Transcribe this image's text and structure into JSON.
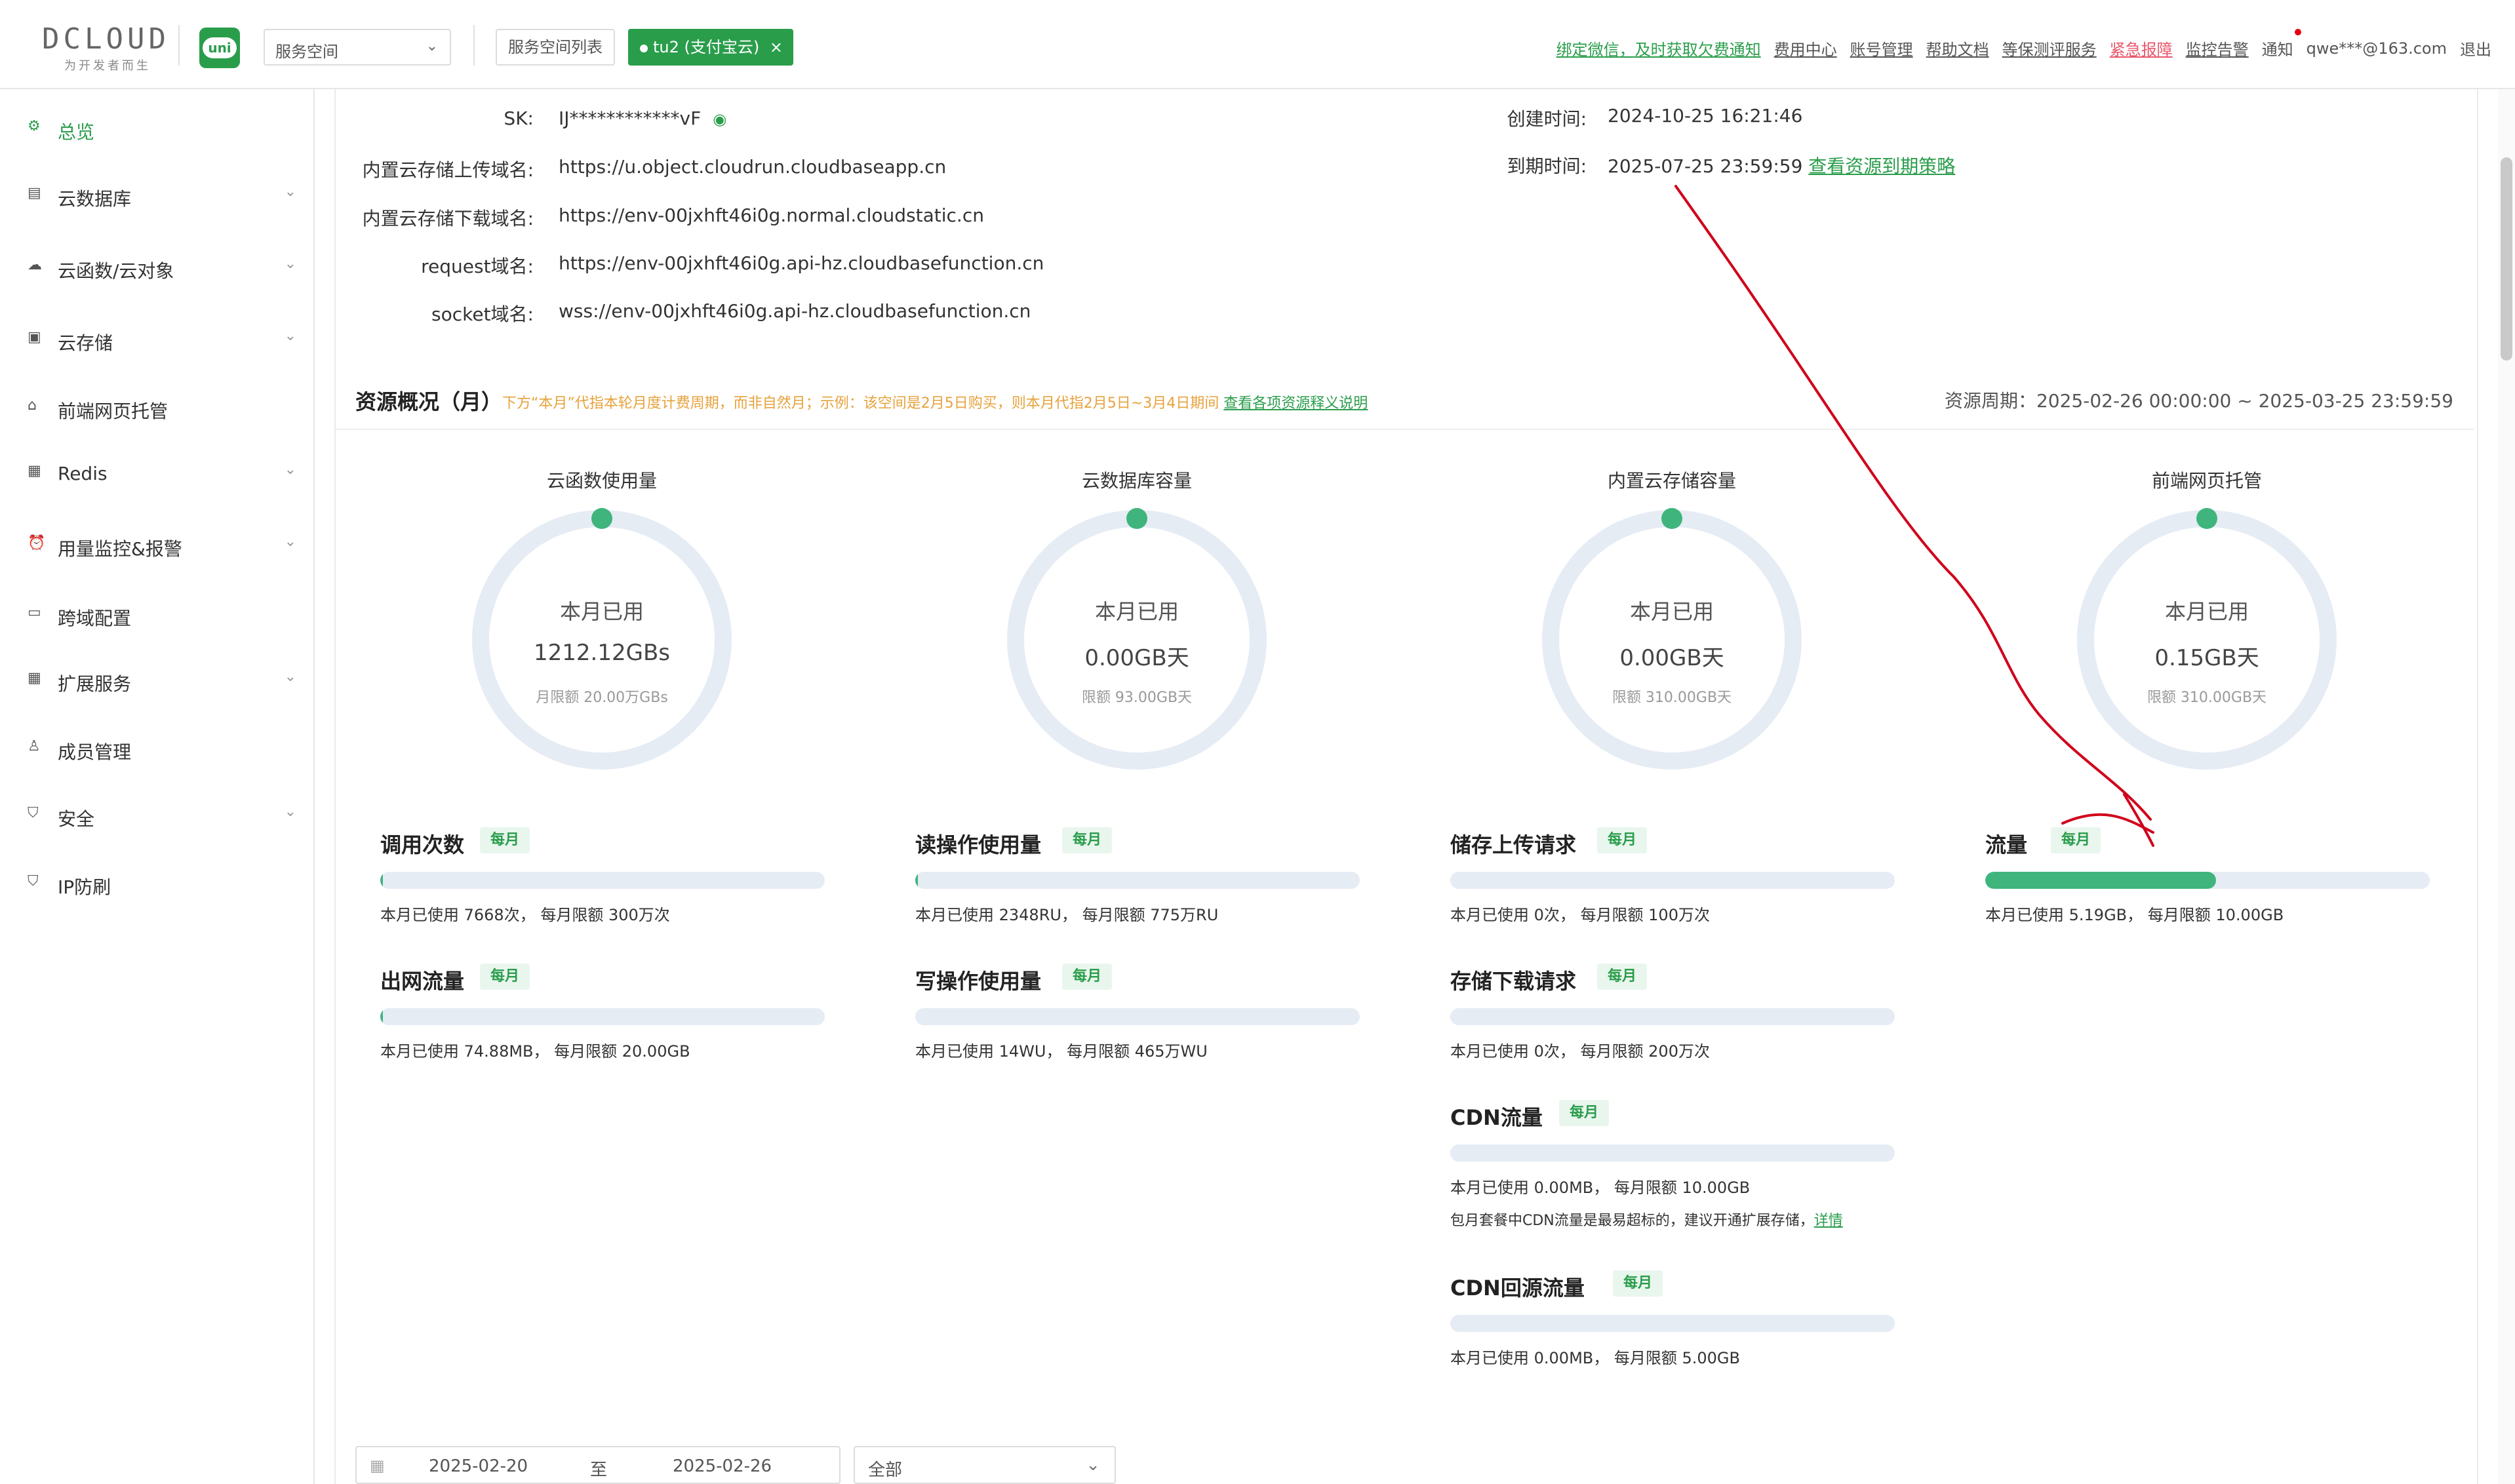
{
  "header": {
    "logo_text": "DCLOUD",
    "logo_sub": "为开发者而生",
    "uni_badge": "uni",
    "space_select": "服务空间",
    "space_list_button": "服务空间列表",
    "env_tag": "tu2 (支付宝云)",
    "env_close": "×",
    "links": {
      "bind_wechat": "绑定微信，及时获取欠费通知",
      "fee_center": "费用中心",
      "account": "账号管理",
      "help": "帮助文档",
      "security_eval": "等保测评服务",
      "report": "紧急报障",
      "monitor": "监控告警",
      "notify": "通知",
      "user": "qwe***@163.com",
      "logout": "退出"
    }
  },
  "sidebar": {
    "items": [
      {
        "label": "总览",
        "icon": "gear-icon",
        "glyph": "⚙",
        "chevron": false,
        "active": true
      },
      {
        "label": "云数据库",
        "icon": "database-icon",
        "glyph": "▤",
        "chevron": true
      },
      {
        "label": "云函数/云对象",
        "icon": "cloud-icon",
        "glyph": "☁",
        "chevron": true
      },
      {
        "label": "云存储",
        "icon": "storage-icon",
        "glyph": "▣",
        "chevron": true
      },
      {
        "label": "前端网页托管",
        "icon": "hosting-icon",
        "glyph": "⌂",
        "chevron": false
      },
      {
        "label": "Redis",
        "icon": "redis-icon",
        "glyph": "▦",
        "chevron": true
      },
      {
        "label": "用量监控&报警",
        "icon": "alarm-icon",
        "glyph": "⏰",
        "chevron": true
      },
      {
        "label": "跨域配置",
        "icon": "cors-icon",
        "glyph": "▭",
        "chevron": false
      },
      {
        "label": "扩展服务",
        "icon": "apps-icon",
        "glyph": "▦",
        "chevron": true
      },
      {
        "label": "成员管理",
        "icon": "user-icon",
        "glyph": "♙",
        "chevron": false
      },
      {
        "label": "安全",
        "icon": "shield-icon",
        "glyph": "⛉",
        "chevron": true
      },
      {
        "label": "IP防刷",
        "icon": "ip-shield-icon",
        "glyph": "⛉",
        "chevron": false
      }
    ],
    "chevron_glyph": "⌄"
  },
  "info": {
    "sk_label": "SK:",
    "sk_value": "IJ************vF",
    "upload_label": "内置云存储上传域名:",
    "upload_value": "https://u.object.cloudrun.cloudbaseapp.cn",
    "download_label": "内置云存储下载域名:",
    "download_value": "https://env-00jxhft46i0g.normal.cloudstatic.cn",
    "request_label": "request域名:",
    "request_value": "https://env-00jxhft46i0g.api-hz.cloudbasefunction.cn",
    "socket_label": "socket域名:",
    "socket_value": "wss://env-00jxhft46i0g.api-hz.cloudbasefunction.cn",
    "created_label": "创建时间:",
    "created_value": "2024-10-25 16:21:46",
    "expire_label": "到期时间:",
    "expire_value": "2025-07-25 23:59:59",
    "expire_link": "查看资源到期策略"
  },
  "overview": {
    "title": "资源概况（月）",
    "note": "下方“本月”代指本轮月度计费周期，而非自然月；示例：该空间是2月5日购买，则本月代指2月5日~3月4日期间",
    "note_link": "查看各项资源释义说明",
    "period": "资源周期：2025-02-26 00:00:00 ~ 2025-03-25 23:59:59"
  },
  "donuts": [
    {
      "title": "云函数使用量",
      "line1": "本月已用",
      "used": "1212.12GBs",
      "limit": "月限额 20.00万GBs"
    },
    {
      "title": "云数据库容量",
      "line1": "本月已用",
      "used": "0.00GB天",
      "limit": "限额 93.00GB天"
    },
    {
      "title": "内置云存储容量",
      "line1": "本月已用",
      "used": "0.00GB天",
      "limit": "限额 310.00GB天"
    },
    {
      "title": "前端网页托管",
      "line1": "本月已用",
      "used": "0.15GB天",
      "limit": "限额 310.00GB天"
    }
  ],
  "metrics": {
    "calls": {
      "name": "调用次数",
      "badge": "每月",
      "desc": "本月已使用 7668次， 每月限额 300万次",
      "fraction": 0.003
    },
    "egress": {
      "name": "出网流量",
      "badge": "每月",
      "desc": "本月已使用 74.88MB， 每月限额 20.00GB",
      "fraction": 0.004
    },
    "read_ops": {
      "name": "读操作使用量",
      "badge": "每月",
      "desc": "本月已使用 2348RU， 每月限额 775万RU",
      "fraction": 0.001
    },
    "write_ops": {
      "name": "写操作使用量",
      "badge": "每月",
      "desc": "本月已使用 14WU， 每月限额 465万WU",
      "fraction": 0.0
    },
    "upload_req": {
      "name": "储存上传请求",
      "badge": "每月",
      "desc": "本月已使用 0次， 每月限额 100万次",
      "fraction": 0.0
    },
    "download_req": {
      "name": "存储下载请求",
      "badge": "每月",
      "desc": "本月已使用 0次， 每月限额 200万次",
      "fraction": 0.0
    },
    "cdn": {
      "name": "CDN流量",
      "badge": "每月",
      "desc": "本月已使用 0.00MB， 每月限额 10.00GB",
      "note": "包月套餐中CDN流量是最易超标的，建议开通扩展存储，",
      "note_link": "详情",
      "fraction": 0.0
    },
    "cdn_origin": {
      "name": "CDN回源流量",
      "badge": "每月",
      "desc": "本月已使用 0.00MB， 每月限额 5.00GB",
      "fraction": 0.0
    },
    "traffic": {
      "name": "流量",
      "badge": "每月",
      "desc": "本月已使用 5.19GB， 每月限额 10.00GB",
      "fraction": 0.519
    }
  },
  "filters": {
    "start_date": "2025-02-20",
    "to": "至",
    "end_date": "2025-02-26",
    "scope": "全部"
  },
  "colors": {
    "brand_green": "#2a9d4b",
    "progress_green": "#3fb57d",
    "track": "#e6ecf4",
    "warning": "#e6a23c",
    "annotation_red": "#d0021b"
  }
}
